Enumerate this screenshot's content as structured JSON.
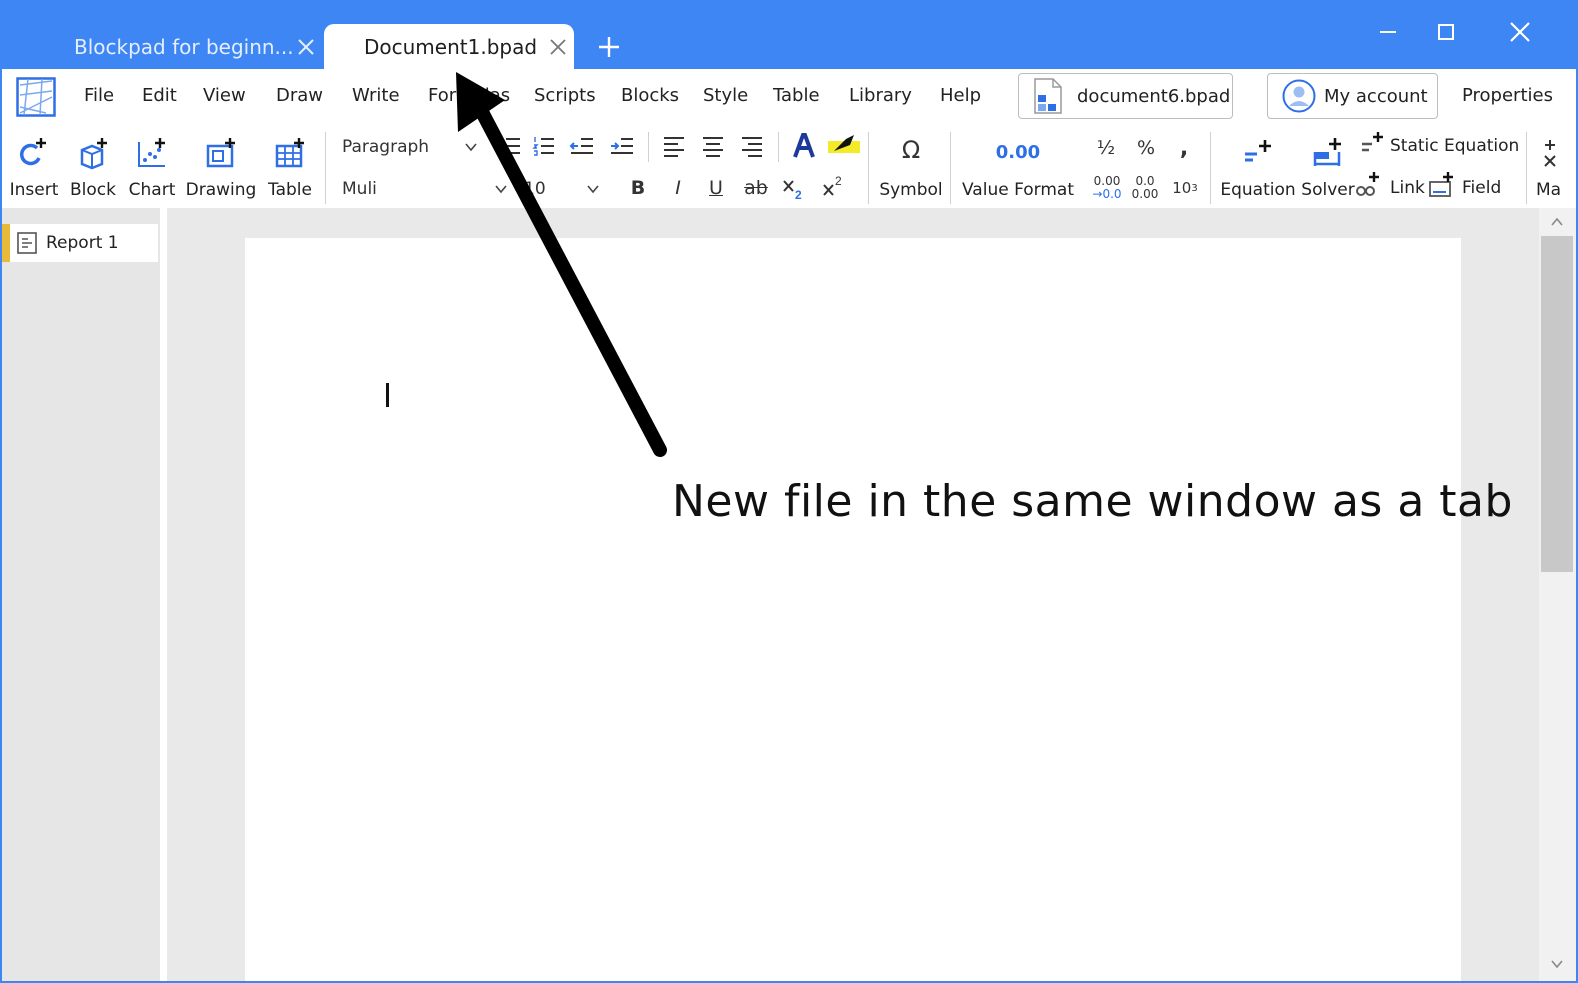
{
  "titlebar": {
    "tabs": [
      {
        "label": "Blockpad for beginn...",
        "active": false
      },
      {
        "label": "Document1.bpad",
        "active": true
      }
    ]
  },
  "menubar": {
    "items": [
      "File",
      "Edit",
      "View",
      "Draw",
      "Write",
      "Formulas",
      "Scripts",
      "Blocks",
      "Style",
      "Table",
      "Library",
      "Help"
    ],
    "document_chip": "document6.bpad",
    "account_chip": "My account",
    "properties": "Properties"
  },
  "toolbar": {
    "insert": "Insert",
    "block": "Block",
    "chart": "Chart",
    "drawing": "Drawing",
    "table": "Table",
    "style_select": "Paragraph",
    "font_select": "Muli",
    "size_select": "10",
    "bold": "B",
    "italic": "I",
    "underline": "U",
    "strike": "ab",
    "symbol_glyph": "Ω",
    "symbol": "Symbol",
    "value_format_glyph": "0.00",
    "value_format": "Value Format",
    "fraction": "½",
    "percent": "%",
    "comma": ",",
    "decimal_increase": "0.00",
    "decimal_decrease": "0.0",
    "sci_notation": "10",
    "sci_exp": "3",
    "equation": "Equation",
    "solver": "Solver",
    "static_equation": "Static Equation",
    "link": "Link",
    "field": "Field",
    "math_partial": "Ma"
  },
  "sidebar": {
    "items": [
      {
        "label": "Report 1"
      }
    ]
  },
  "annotation": {
    "text": "New file in the same window as a tab"
  },
  "colors": {
    "titlebar": "#3f86f5",
    "accent_blue": "#2f6fe6",
    "report_marker": "#e9b93a"
  }
}
